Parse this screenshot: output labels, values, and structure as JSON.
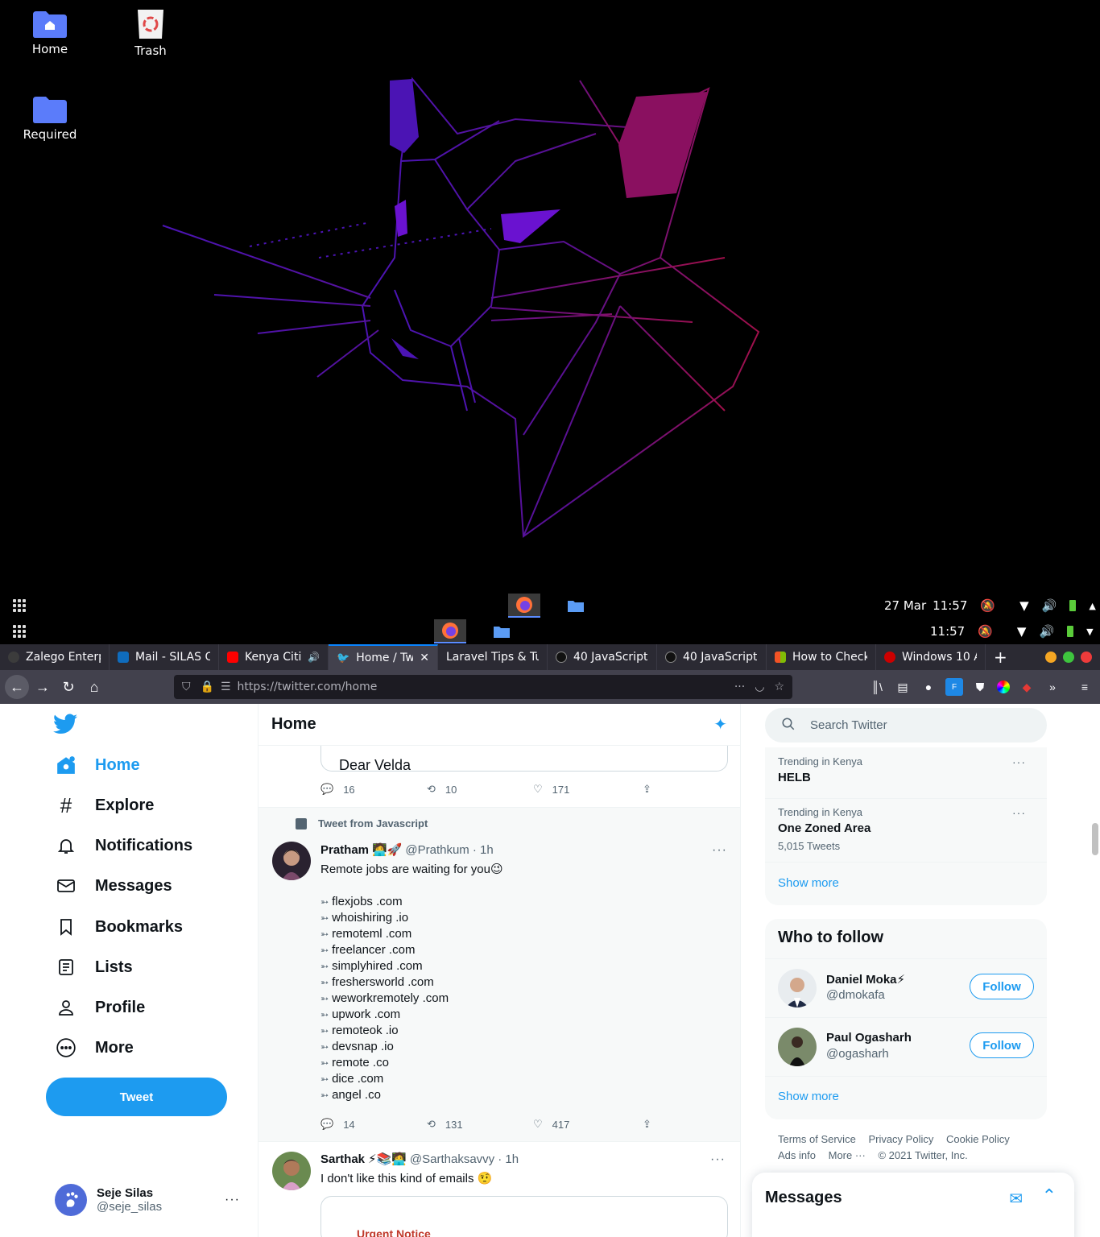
{
  "desktop": {
    "icons": [
      {
        "label": "Home",
        "icon": "home-folder-icon"
      },
      {
        "label": "Trash",
        "icon": "trash-icon"
      },
      {
        "label": "Required",
        "icon": "folder-icon"
      }
    ],
    "panel_top": {
      "date": "27 Mar",
      "time": "11:57"
    },
    "panel_bottom": {
      "time": "11:57"
    }
  },
  "browser": {
    "tabs": [
      {
        "label": "Zalego Enterp",
        "color": "#3c3c3c"
      },
      {
        "label": "Mail - SILAS O",
        "color": "#0f6cbd"
      },
      {
        "label": "Kenya Citiz",
        "color": "#ff0000"
      },
      {
        "label": "Home / Twi",
        "color": "#1d9bf0"
      },
      {
        "label": "Laravel Tips & Tu",
        "color": "#f05340"
      },
      {
        "label": "40 JavaScript",
        "color": "#111111"
      },
      {
        "label": "40 JavaScript",
        "color": "#111111"
      },
      {
        "label": "How to Check",
        "color": "#0078d4"
      },
      {
        "label": "Windows 10 A",
        "color": "#cc0000"
      }
    ],
    "url": "https://twitter.com/home"
  },
  "nav": {
    "items": [
      "Home",
      "Explore",
      "Notifications",
      "Messages",
      "Bookmarks",
      "Lists",
      "Profile",
      "More"
    ],
    "tweet_button": "Tweet",
    "account": {
      "name": "Seje Silas",
      "handle": "@seje_silas"
    }
  },
  "timeline": {
    "title": "Home",
    "prev_card_text": "Dear Velda",
    "prev_stats": {
      "replies": "16",
      "retweets": "10",
      "likes": "171"
    },
    "tweet1": {
      "context": "Tweet from Javascript",
      "name": "Pratham",
      "emoji": "🧑‍💻🚀",
      "handle": "@Prathkum",
      "time": "· 1h",
      "text": "Remote jobs are waiting for you😉",
      "links": [
        "flexjobs .com",
        "whoishiring .io",
        "remoteml .com",
        "freelancer .com",
        "simplyhired .com",
        "freshersworld .com",
        "weworkremotely .com",
        "upwork .com",
        "remoteok .io",
        "devsnap .io",
        "remote .co",
        "dice .com",
        "angel .co"
      ],
      "stats": {
        "replies": "14",
        "retweets": "131",
        "likes": "417"
      }
    },
    "tweet2": {
      "name": "Sarthak",
      "emoji": "⚡📚🧑‍💻",
      "handle": "@Sarthaksavvy",
      "time": "· 1h",
      "text": "I don't like this kind of emails 🤨",
      "card_text": "Urgent Notice"
    }
  },
  "sidebar": {
    "search_placeholder": "Search Twitter",
    "trends": [
      {
        "meta": "Trending in Kenya",
        "name": "HELB",
        "count": ""
      },
      {
        "meta": "Trending in Kenya",
        "name": "One Zoned Area",
        "count": "5,015 Tweets"
      }
    ],
    "show_more": "Show more",
    "who_to_follow": "Who to follow",
    "follow": [
      {
        "name": "Daniel Moka⚡",
        "handle": "@dmokafa",
        "button": "Follow"
      },
      {
        "name": "Paul Ogasharh",
        "handle": "@ogasharh",
        "button": "Follow"
      }
    ],
    "footer": {
      "line1": [
        "Terms of Service",
        "Privacy Policy",
        "Cookie Policy"
      ],
      "line2": [
        "Ads info",
        "More ···",
        "© 2021 Twitter, Inc."
      ]
    },
    "messages": "Messages"
  },
  "colors": {
    "accent": "#1d9bf0",
    "desktop_bg": "#000000",
    "browser_chrome": "#2b2a33"
  }
}
